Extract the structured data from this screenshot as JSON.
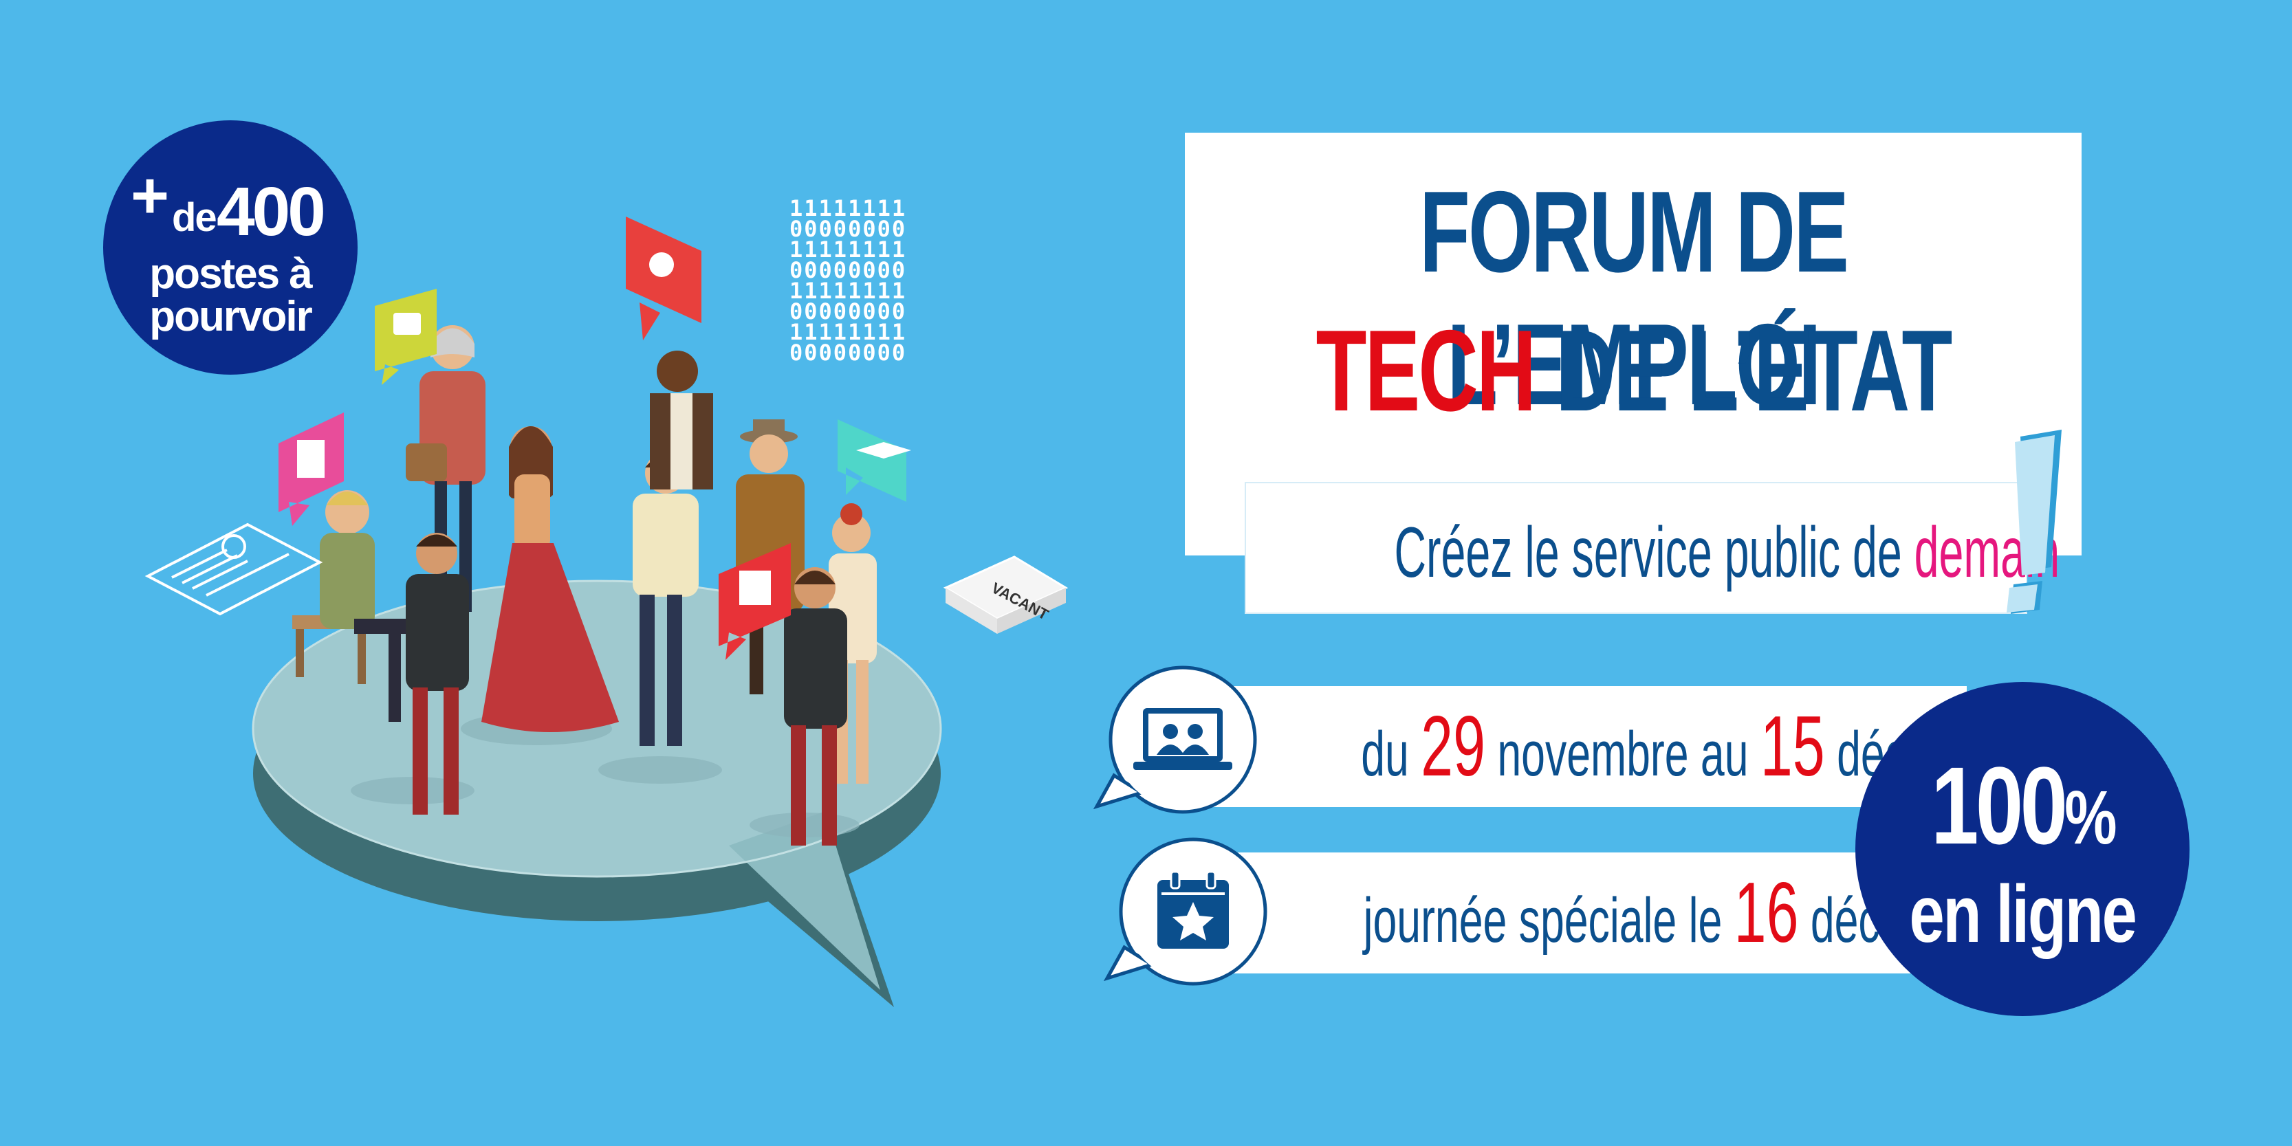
{
  "colors": {
    "background": "#4eb8ea",
    "navy": "#0a2a8a",
    "title_blue": "#0b4f8d",
    "red": "#e20b16",
    "pink": "#e5177e"
  },
  "badge_postes": {
    "plus": "+",
    "de": "de",
    "number": "400",
    "line2": "postes à",
    "line3": "pourvoir"
  },
  "binary_rows": [
    "11111111",
    "00000000",
    "11111111",
    "00000000",
    "11111111",
    "00000000",
    "11111111",
    "00000000"
  ],
  "illustration": {
    "sign_label": "VACANT"
  },
  "title": {
    "line1": "FORUM DE L’EMPLOI",
    "line2_highlight": "TECH",
    "line2_rest": " DE L’ÉTAT"
  },
  "subtitle": {
    "text": "Créez le service public de ",
    "highlight": "demain"
  },
  "dates": {
    "row1": {
      "pre": "du ",
      "day1": "29",
      "mid": " novembre au ",
      "day2": "15",
      "post": " décembre",
      "icon": "video-conference-icon"
    },
    "row2": {
      "pre": "journée spéciale le ",
      "day": "16",
      "post": " décembre",
      "icon": "calendar-star-icon"
    }
  },
  "badge_online": {
    "number": "100",
    "symbol": "%",
    "line2": "en ligne"
  }
}
